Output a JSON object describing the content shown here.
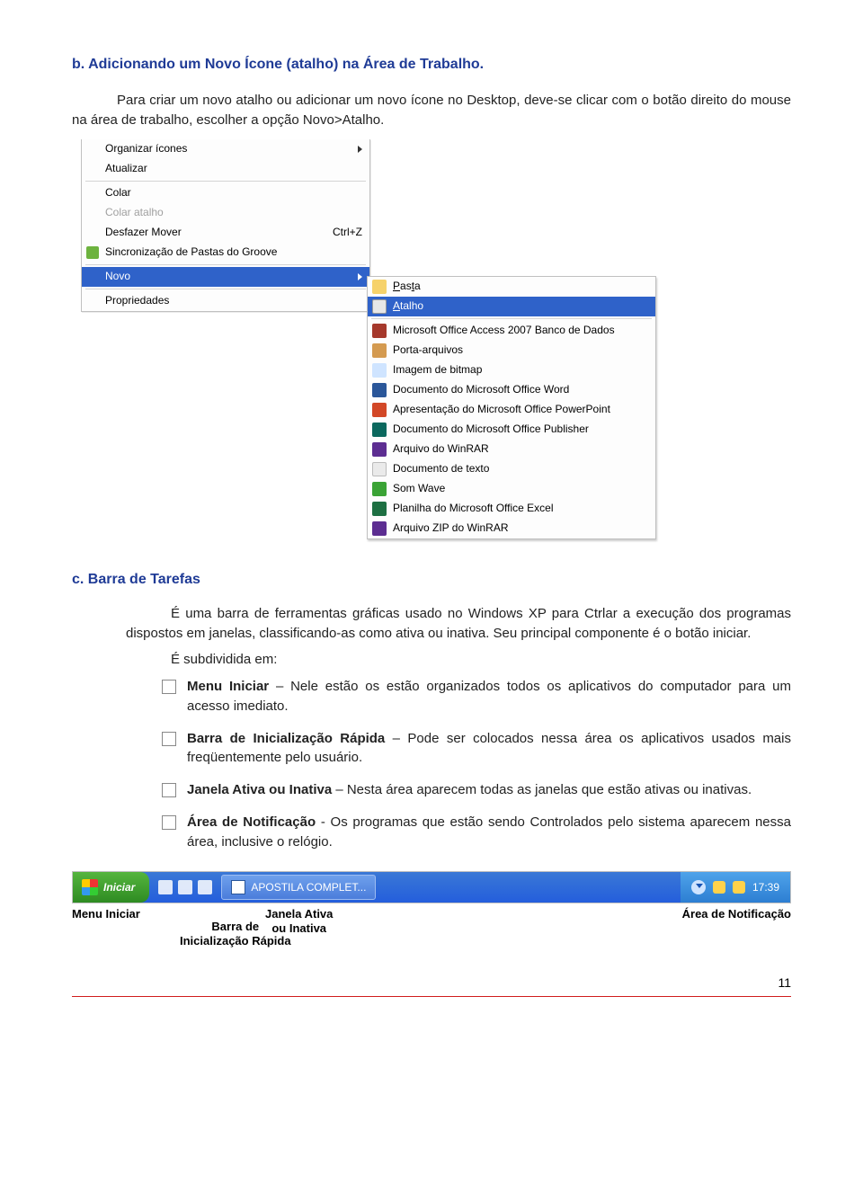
{
  "heading_b": "b. Adicionando um Novo Ícone (atalho) na Área de Trabalho.",
  "intro": "Para criar um novo atalho ou adicionar um novo ícone no Desktop, deve-se clicar com o botão direito do mouse na área de trabalho, escolher a opção Novo>Atalho.",
  "ctx_menu": {
    "organizar": "Organizar ícones",
    "atualizar": "Atualizar",
    "colar": "Colar",
    "colar_atalho": "Colar atalho",
    "desfazer": "Desfazer Mover",
    "desfazer_sc": "Ctrl+Z",
    "sinc": "Sincronização de Pastas do Groove",
    "novo": "Novo",
    "propriedades": "Propriedades"
  },
  "sub_menu": {
    "pasta": "Pasta",
    "atalho": "Atalho",
    "access": "Microsoft Office Access 2007 Banco de Dados",
    "porta": "Porta-arquivos",
    "bmp": "Imagem de bitmap",
    "word": "Documento do Microsoft Office Word",
    "ppt": "Apresentação do Microsoft Office PowerPoint",
    "pub": "Documento do Microsoft Office Publisher",
    "rar": "Arquivo do WinRAR",
    "txt": "Documento de texto",
    "wav": "Som Wave",
    "excel": "Planilha do Microsoft Office Excel",
    "zip": "Arquivo ZIP do WinRAR"
  },
  "heading_c": "c. Barra de Tarefas",
  "barra_p": "É uma barra de ferramentas gráficas usado no Windows XP para Ctrlar a execução dos programas dispostos em janelas, classificando-as como ativa ou inativa. Seu principal componente é o botão iniciar.",
  "sub_div": "É subdividida em:",
  "bullets": {
    "menu_ini_t": "Menu Iniciar",
    "menu_ini_b": " – Nele estão os estão organizados todos os aplicativos do computador para um acesso imediato.",
    "barra_ir_t": "Barra de Inicialização Rápida",
    "barra_ir_b": " – Pode ser colocados nessa área os aplicativos usados mais freqüentemente pelo usuário.",
    "janela_t": "Janela Ativa ou Inativa",
    "janela_b": " – Nesta área aparecem todas as janelas que estão ativas ou inativas.",
    "area_n_t": "Área de Notificação",
    "area_n_b": " - Os programas que estão sendo Controlados pelo sistema aparecem nessa área, inclusive o relógio."
  },
  "taskbar": {
    "start": "Iniciar",
    "task_label": "APOSTILA COMPLET...",
    "clock": "17:39"
  },
  "tb_labels": {
    "menu": "Menu Iniciar",
    "barra": "Barra de\nInicialização Rápida",
    "janela": "Janela Ativa\nou Inativa",
    "area": "Área de Notificação"
  },
  "page_num": "11"
}
